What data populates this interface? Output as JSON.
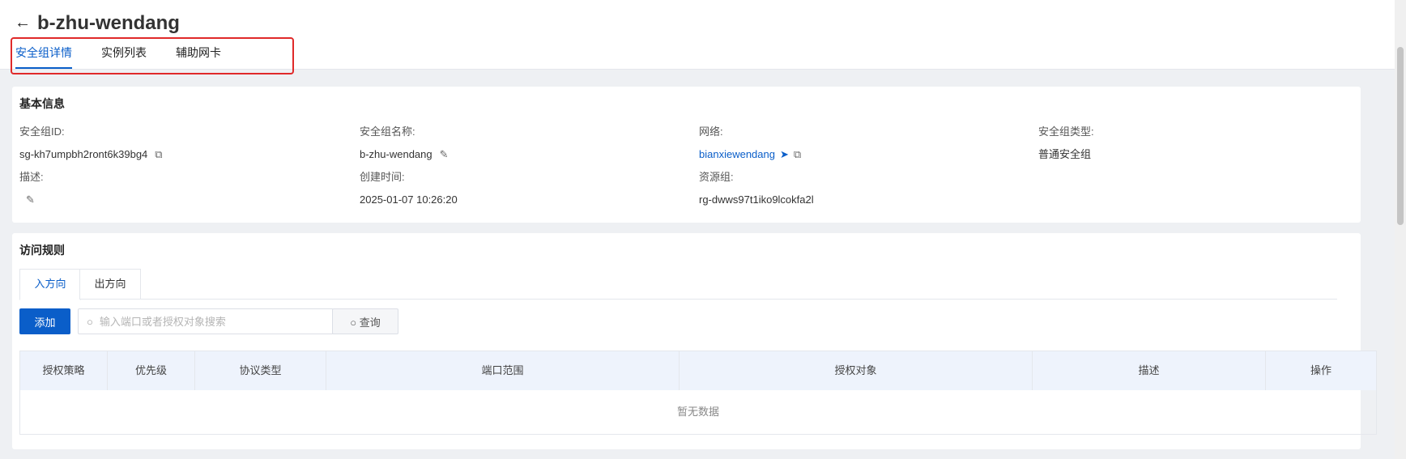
{
  "header": {
    "title": "b-zhu-wendang",
    "tabs": [
      "安全组详情",
      "实例列表",
      "辅助网卡"
    ]
  },
  "basic_info": {
    "title": "基本信息",
    "fields": {
      "id_label": "安全组ID:",
      "id_value": "sg-kh7umpbh2ront6k39bg4",
      "name_label": "安全组名称:",
      "name_value": "b-zhu-wendang",
      "network_label": "网络:",
      "network_value": "bianxiewendang",
      "type_label": "安全组类型:",
      "type_value": "普通安全组",
      "desc_label": "描述:",
      "created_label": "创建时间:",
      "created_value": "2025-01-07 10:26:20",
      "rg_label": "资源组:",
      "rg_value": "rg-dwws97t1iko9lcokfa2l"
    }
  },
  "access_rules": {
    "title": "访问规则",
    "direction_tabs": [
      "入方向",
      "出方向"
    ],
    "add_label": "添加",
    "search_placeholder": "输入端口或者授权对象搜索",
    "query_label": "查询",
    "columns": [
      "授权策略",
      "优先级",
      "协议类型",
      "端口范围",
      "授权对象",
      "描述",
      "操作"
    ],
    "empty_text": "暂无数据"
  },
  "colors": {
    "accent": "#0a5ec9",
    "highlight_box": "#e02a2a"
  },
  "icons": [
    "back-arrow-icon",
    "copy-icon",
    "edit-icon",
    "send-icon",
    "search-icon"
  ]
}
